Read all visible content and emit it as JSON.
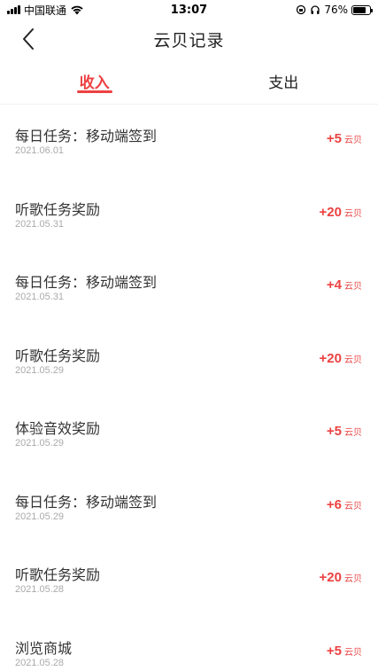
{
  "status_bar": {
    "carrier": "中国联通",
    "time": "13:07",
    "battery": "76%",
    "battery_level": 0.76
  },
  "nav": {
    "title": "云贝记录"
  },
  "tabs": [
    {
      "label": "收入",
      "active": true
    },
    {
      "label": "支出",
      "active": false
    }
  ],
  "records": [
    {
      "title": "每日任务：移动端签到",
      "date": "2021.06.01",
      "amount": "+5",
      "unit": "云贝"
    },
    {
      "title": "听歌任务奖励",
      "date": "2021.05.31",
      "amount": "+20",
      "unit": "云贝"
    },
    {
      "title": "每日任务：移动端签到",
      "date": "2021.05.31",
      "amount": "+4",
      "unit": "云贝"
    },
    {
      "title": "听歌任务奖励",
      "date": "2021.05.29",
      "amount": "+20",
      "unit": "云贝"
    },
    {
      "title": "体验音效奖励",
      "date": "2021.05.29",
      "amount": "+5",
      "unit": "云贝"
    },
    {
      "title": "每日任务：移动端签到",
      "date": "2021.05.29",
      "amount": "+6",
      "unit": "云贝"
    },
    {
      "title": "听歌任务奖励",
      "date": "2021.05.28",
      "amount": "+20",
      "unit": "云贝"
    },
    {
      "title": "浏览商城",
      "date": "2021.05.28",
      "amount": "+5",
      "unit": "云贝"
    }
  ],
  "colors": {
    "accent": "#ec4141"
  }
}
